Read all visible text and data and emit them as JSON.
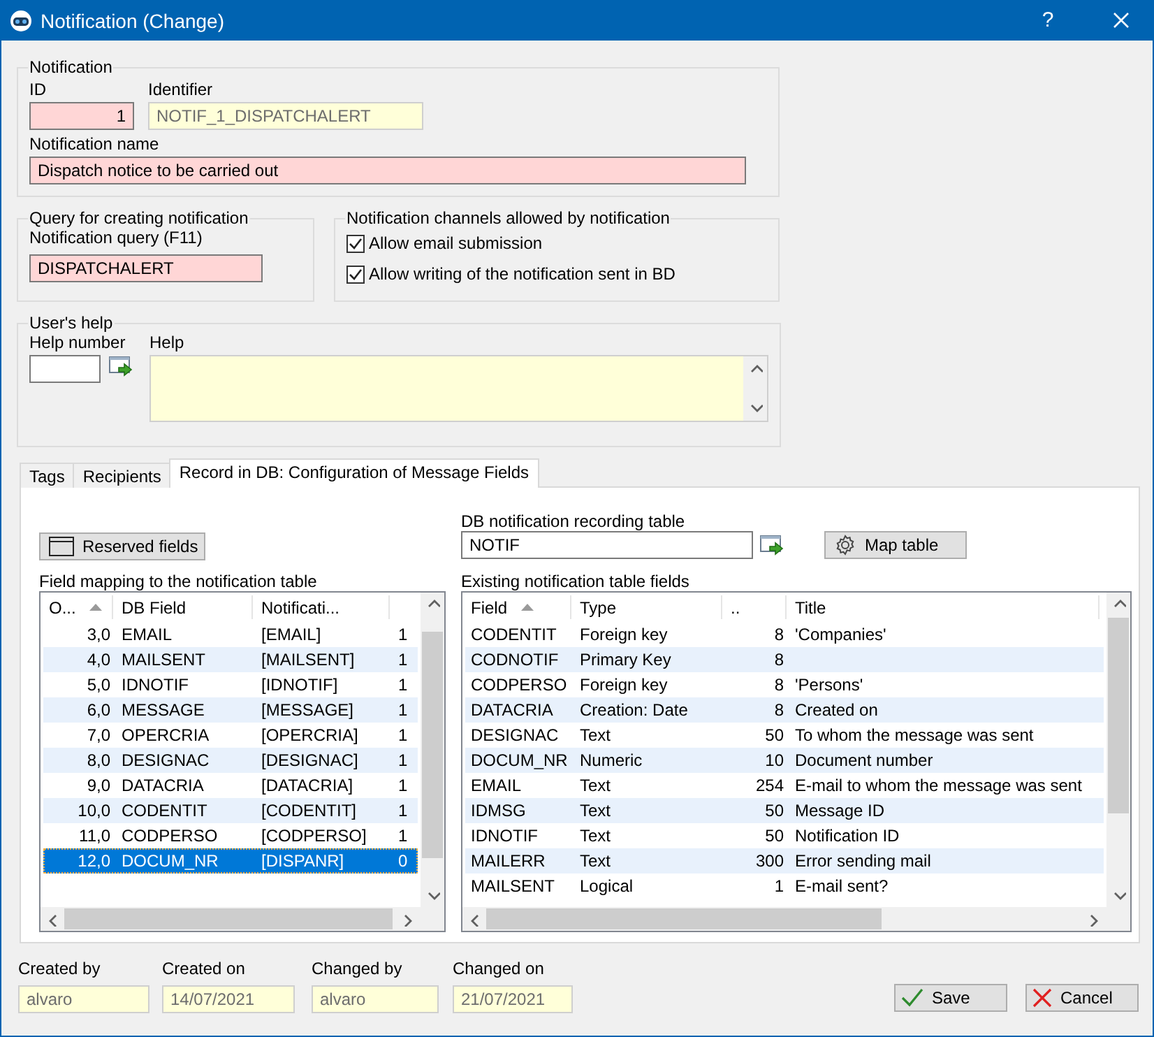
{
  "window": {
    "title": "Notification (Change)",
    "help_button": "?"
  },
  "notification": {
    "legend": "Notification",
    "fields": [
      {
        "label": "ID",
        "value": "1",
        "kind": "required"
      },
      {
        "label": "Identifier",
        "value": "NOTIF_1_DISPATCHALERT",
        "kind": "readonly"
      }
    ],
    "name": {
      "label": "Notification name",
      "value": "Dispatch notice to be carried out",
      "kind": "required"
    }
  },
  "query": {
    "legend": "Query for creating notification",
    "label": "Notification query (F11)",
    "value": "DISPATCHALERT",
    "kind": "required"
  },
  "channels": {
    "legend": "Notification channels allowed by notification",
    "options": [
      {
        "label": "Allow email submission",
        "checked": true
      },
      {
        "label": "Allow writing of the notification sent in BD",
        "checked": true
      }
    ]
  },
  "users_help": {
    "legend": "User's help",
    "help_number": {
      "label": "Help number",
      "kind": "normal"
    },
    "help": {
      "label": "Help",
      "kind": "readonly"
    }
  },
  "tabs": [
    {
      "label": "Tags",
      "selected": false
    },
    {
      "label": "Recipients",
      "selected": false
    },
    {
      "label": "Record in DB: Configuration of Message Fields",
      "selected": true
    }
  ],
  "reserved_button": "Reserved fields",
  "mapping": {
    "label": "Field mapping to the notification table",
    "columns": [
      {
        "label": "O...",
        "sorted": true
      },
      {
        "label": "DB Field",
        "sorted": false
      },
      {
        "label": "Notificati...",
        "sorted": false
      }
    ],
    "rows": [
      {
        "cells": [
          "3,0",
          "EMAIL",
          "[EMAIL]",
          "1"
        ],
        "selected": false
      },
      {
        "cells": [
          "4,0",
          "MAILSENT",
          "[MAILSENT]",
          "1"
        ],
        "selected": false
      },
      {
        "cells": [
          "5,0",
          "IDNOTIF",
          "[IDNOTIF]",
          "1"
        ],
        "selected": false
      },
      {
        "cells": [
          "6,0",
          "MESSAGE",
          "[MESSAGE]",
          "1"
        ],
        "selected": false
      },
      {
        "cells": [
          "7,0",
          "OPERCRIA",
          "[OPERCRIA]",
          "1"
        ],
        "selected": false
      },
      {
        "cells": [
          "8,0",
          "DESIGNAC",
          "[DESIGNAC]",
          "1"
        ],
        "selected": false
      },
      {
        "cells": [
          "9,0",
          "DATACRIA",
          "[DATACRIA]",
          "1"
        ],
        "selected": false
      },
      {
        "cells": [
          "10,0",
          "CODENTIT",
          "[CODENTIT]",
          "1"
        ],
        "selected": false
      },
      {
        "cells": [
          "11,0",
          "CODPERSO",
          "[CODPERSO]",
          "1"
        ],
        "selected": false
      },
      {
        "cells": [
          "12,0",
          "DOCUM_NR",
          "[DISPANR]",
          "0"
        ],
        "selected": true
      }
    ]
  },
  "recording_table": {
    "label": "DB notification recording table",
    "value": "NOTIF",
    "kind": "normal"
  },
  "map_button": "Map table",
  "existing": {
    "label": "Existing notification table fields",
    "columns": [
      {
        "label": "Field",
        "sorted": true
      },
      {
        "label": "Type",
        "sorted": false
      },
      {
        "label": "..",
        "sorted": false
      },
      {
        "label": "Title",
        "sorted": false
      }
    ],
    "rows": [
      {
        "cells": [
          "CODENTIT",
          "Foreign key",
          "8",
          "'Companies'"
        ],
        "selected": false
      },
      {
        "cells": [
          "CODNOTIF",
          "Primary Key",
          "8",
          null
        ],
        "selected": false
      },
      {
        "cells": [
          "CODPERSO",
          "Foreign key",
          "8",
          "'Persons'"
        ],
        "selected": false
      },
      {
        "cells": [
          "DATACRIA",
          "Creation: Date",
          "8",
          "Created on"
        ],
        "selected": false
      },
      {
        "cells": [
          "DESIGNAC",
          "Text",
          "50",
          "To whom the message was sent"
        ],
        "selected": false
      },
      {
        "cells": [
          "DOCUM_NR",
          "Numeric",
          "10",
          "Document number"
        ],
        "selected": false
      },
      {
        "cells": [
          "EMAIL",
          "Text",
          "254",
          "E-mail to whom the message was sent"
        ],
        "selected": false
      },
      {
        "cells": [
          "IDMSG",
          "Text",
          "50",
          "Message ID"
        ],
        "selected": false
      },
      {
        "cells": [
          "IDNOTIF",
          "Text",
          "50",
          "Notification ID"
        ],
        "selected": false
      },
      {
        "cells": [
          "MAILERR",
          "Text",
          "300",
          "Error sending mail"
        ],
        "selected": false
      },
      {
        "cells": [
          "MAILSENT",
          "Logical",
          "1",
          "E-mail sent?"
        ],
        "selected": false
      }
    ]
  },
  "footer": {
    "fields": [
      {
        "label": "Created by",
        "value": "alvaro",
        "kind": "readonly"
      },
      {
        "label": "Created on",
        "value": "14/07/2021",
        "kind": "readonly"
      },
      {
        "label": "Changed by",
        "value": "alvaro",
        "kind": "readonly"
      },
      {
        "label": "Changed on",
        "value": "21/07/2021",
        "kind": "readonly"
      }
    ]
  },
  "buttons": [
    {
      "label": "Save",
      "kind": "save"
    },
    {
      "label": "Cancel",
      "kind": "cancel"
    }
  ]
}
